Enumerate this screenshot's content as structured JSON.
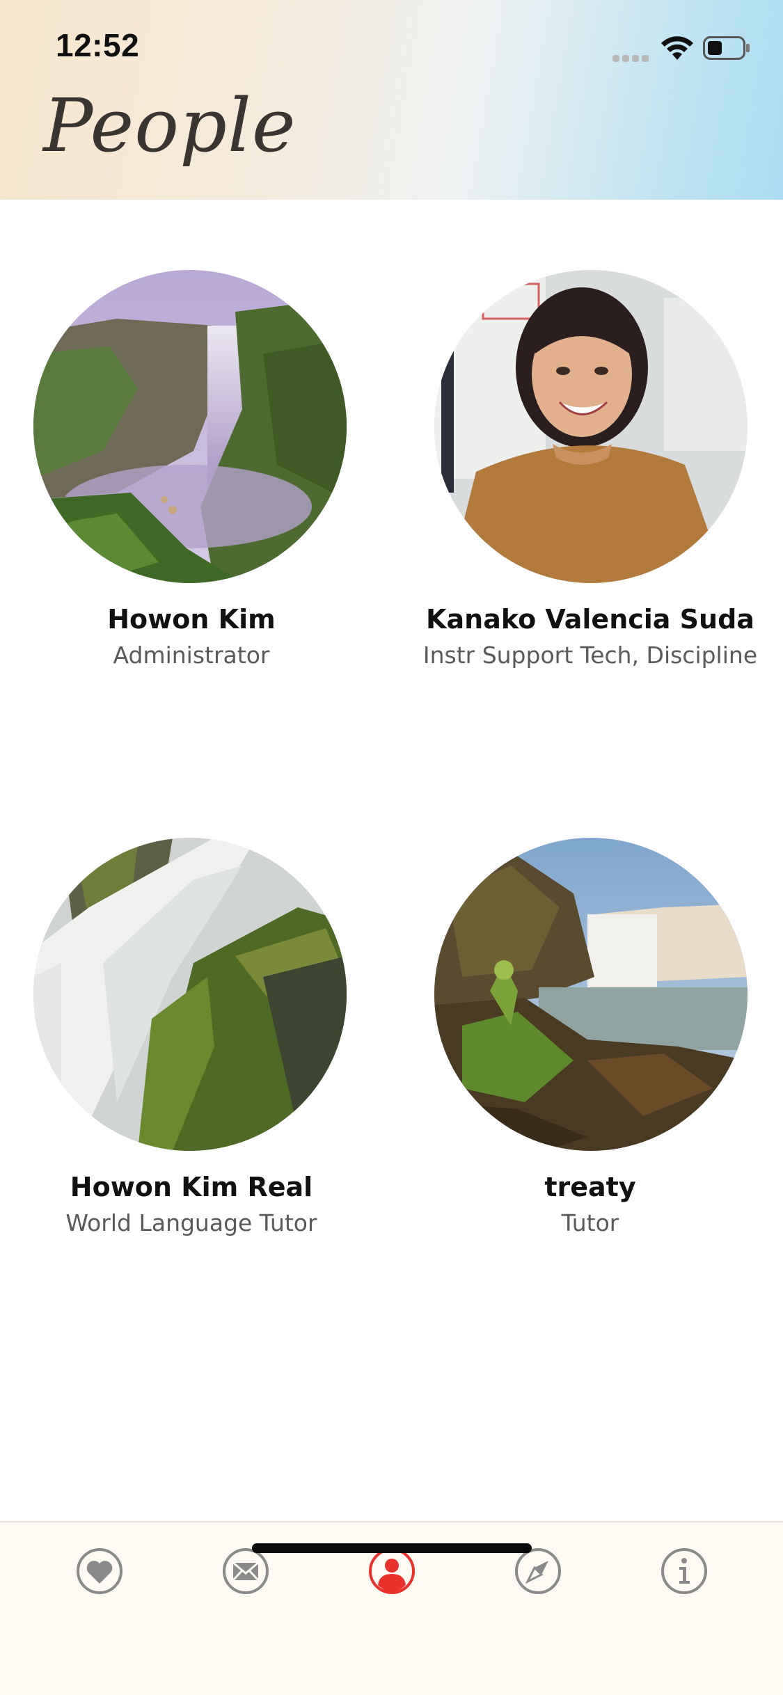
{
  "status_bar": {
    "time": "12:52"
  },
  "header": {
    "title": "People"
  },
  "people": [
    {
      "name": "Howon Kim",
      "role": "Administrator",
      "avatar": "waterfall-cliff-photo"
    },
    {
      "name": "Kanako Valencia Suda",
      "role": "Instr Support Tech, Discipline",
      "avatar": "portrait-photo"
    },
    {
      "name": "Howon Kim Real",
      "role": "World Language Tutor",
      "avatar": "cascade-rocks-photo"
    },
    {
      "name": "treaty",
      "role": "Tutor",
      "avatar": "waterfall-shore-photo"
    }
  ],
  "tabbar": {
    "items": [
      {
        "icon": "heart-icon",
        "active": false
      },
      {
        "icon": "envelope-icon",
        "active": false
      },
      {
        "icon": "person-icon",
        "active": true
      },
      {
        "icon": "compass-icon",
        "active": false
      },
      {
        "icon": "info-icon",
        "active": false
      }
    ],
    "active_color": "#e8322b",
    "inactive_color": "#8a8a8a"
  }
}
